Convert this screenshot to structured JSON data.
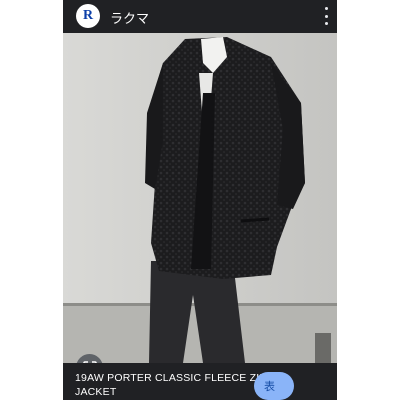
{
  "header": {
    "app_logo_letter": "R",
    "app_name": "ラクマ"
  },
  "photo": {
    "subject": "black fleece zip jacket"
  },
  "caption": {
    "title_line1": "19AW PORTER CLASSIC FLEECE ZIP",
    "title_line2": "JACKET"
  },
  "visit_button": {
    "label": "表"
  },
  "colors": {
    "background": "#202124",
    "text": "#ffffff",
    "chip": "#8ab4f8"
  }
}
